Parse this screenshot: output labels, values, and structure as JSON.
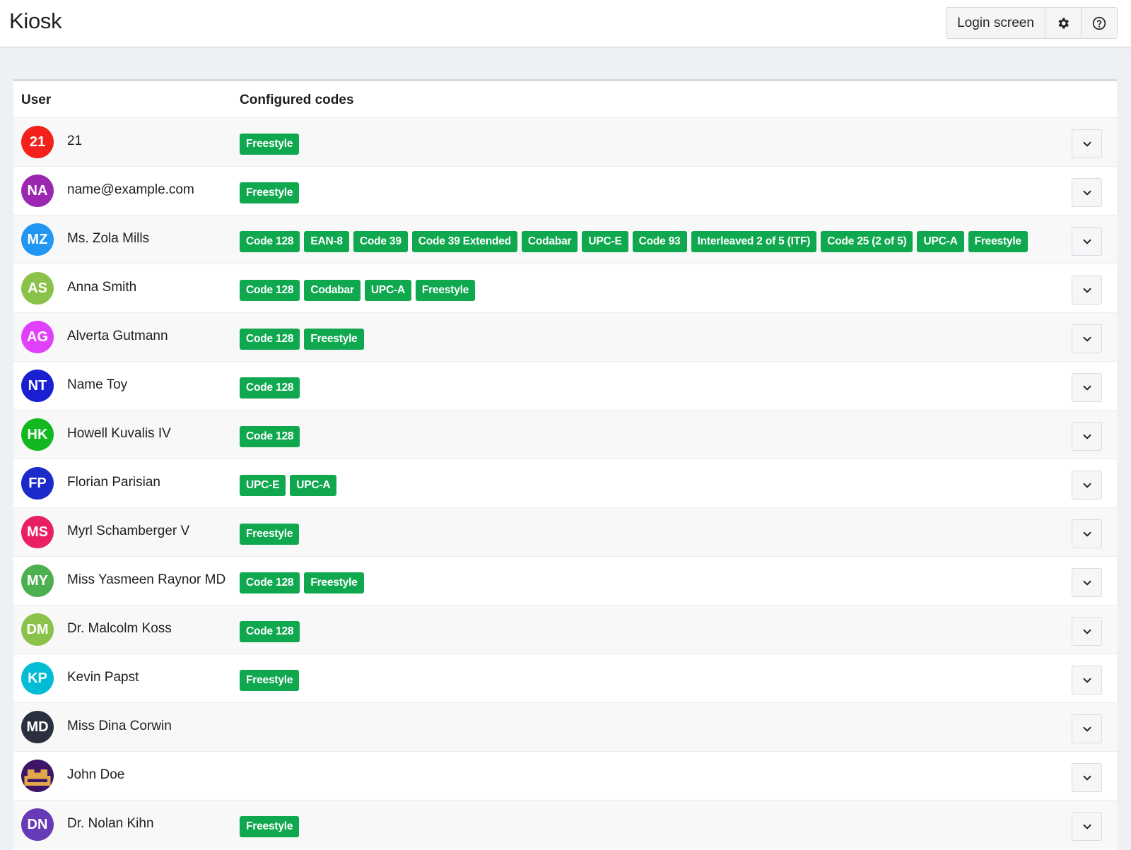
{
  "app": {
    "title": "Kiosk"
  },
  "header": {
    "login_label": "Login screen",
    "settings_icon": "gear-icon",
    "help_icon": "question-circle-icon"
  },
  "table": {
    "columns": {
      "user": "User",
      "codes": "Configured codes"
    },
    "tag_color": "#0fa84f",
    "rows": [
      {
        "initials": "21",
        "name": "21",
        "color": "#f2211c",
        "codes": [
          "Freestyle"
        ]
      },
      {
        "initials": "NA",
        "name": "name@example.com",
        "color": "#9b27b0",
        "codes": [
          "Freestyle"
        ]
      },
      {
        "initials": "MZ",
        "name": "Ms. Zola Mills",
        "color": "#2196f3",
        "codes": [
          "Code 128",
          "EAN-8",
          "Code 39",
          "Code 39 Extended",
          "Codabar",
          "UPC-E",
          "Code 93",
          "Interleaved 2 of 5 (ITF)",
          "Code 25 (2 of 5)",
          "UPC-A",
          "Freestyle"
        ]
      },
      {
        "initials": "AS",
        "name": "Anna Smith",
        "color": "#8bc34a",
        "codes": [
          "Code 128",
          "Codabar",
          "UPC-A",
          "Freestyle"
        ]
      },
      {
        "initials": "AG",
        "name": "Alverta Gutmann",
        "color": "#e040fb",
        "codes": [
          "Code 128",
          "Freestyle"
        ]
      },
      {
        "initials": "NT",
        "name": "Name Toy",
        "color": "#1a1fd1",
        "codes": [
          "Code 128"
        ]
      },
      {
        "initials": "HK",
        "name": "Howell Kuvalis IV",
        "color": "#12b81f",
        "codes": [
          "Code 128"
        ]
      },
      {
        "initials": "FP",
        "name": "Florian Parisian",
        "color": "#1a2bc9",
        "codes": [
          "UPC-E",
          "UPC-A"
        ]
      },
      {
        "initials": "MS",
        "name": "Myrl Schamberger V",
        "color": "#e91e63",
        "codes": [
          "Freestyle"
        ]
      },
      {
        "initials": "MY",
        "name": "Miss Yasmeen Raynor MD",
        "color": "#4caf50",
        "codes": [
          "Code 128",
          "Freestyle"
        ]
      },
      {
        "initials": "DM",
        "name": "Dr. Malcolm Koss",
        "color": "#8bc34a",
        "codes": [
          "Code 128"
        ]
      },
      {
        "initials": "KP",
        "name": "Kevin Papst",
        "color": "#00bcd4",
        "codes": [
          "Freestyle"
        ]
      },
      {
        "initials": "MD",
        "name": "Miss Dina Corwin",
        "color": "#2b3040",
        "codes": []
      },
      {
        "initials": "",
        "name": "John Doe",
        "color": "#3d1466",
        "avatar_type": "pixel-art",
        "codes": []
      },
      {
        "initials": "DN",
        "name": "Dr. Nolan Kihn",
        "color": "#673ab7",
        "codes": [
          "Freestyle"
        ]
      }
    ]
  }
}
